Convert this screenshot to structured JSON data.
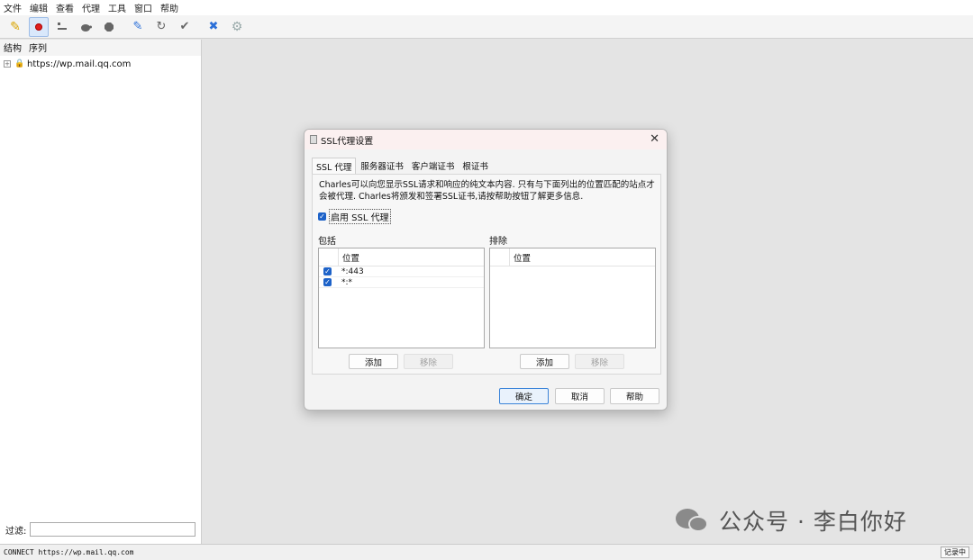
{
  "menubar": {
    "items": [
      "文件",
      "编辑",
      "查看",
      "代理",
      "工具",
      "窗口",
      "帮助"
    ]
  },
  "toolbar": {
    "icons": [
      "broom-icon",
      "record-icon",
      "throttle-icon",
      "turtle-icon",
      "stop-icon",
      "pen-icon",
      "refresh-icon",
      "check-icon",
      "tools-icon",
      "gear-icon"
    ]
  },
  "left_panel": {
    "tabs": [
      "结构",
      "序列"
    ],
    "tree": [
      {
        "label": "https://wp.mail.qq.com"
      }
    ],
    "filter_label": "过滤:"
  },
  "status": {
    "text": "CONNECT https://wp.mail.qq.com",
    "recording": "记录中"
  },
  "watermark": {
    "text": "公众号 · 李白你好"
  },
  "dialog": {
    "title": "SSL代理设置",
    "tabs": [
      "SSL 代理",
      "服务器证书",
      "客户端证书",
      "根证书"
    ],
    "description": "Charles可以向您显示SSL请求和响应的纯文本内容. 只有与下面列出的位置匹配的站点才会被代理. Charles将颁发和签署SSL证书,请按帮助按钮了解更多信息.",
    "enable_label": "启用 SSL 代理",
    "enable_checked": true,
    "include": {
      "title": "包括",
      "column": "位置",
      "rows": [
        {
          "location": "*:443",
          "checked": true
        },
        {
          "location": "*:*",
          "checked": true
        }
      ],
      "add": "添加",
      "remove": "移除"
    },
    "exclude": {
      "title": "排除",
      "column": "位置",
      "add": "添加",
      "remove": "移除"
    },
    "ok": "确定",
    "cancel": "取消",
    "help": "帮助"
  }
}
